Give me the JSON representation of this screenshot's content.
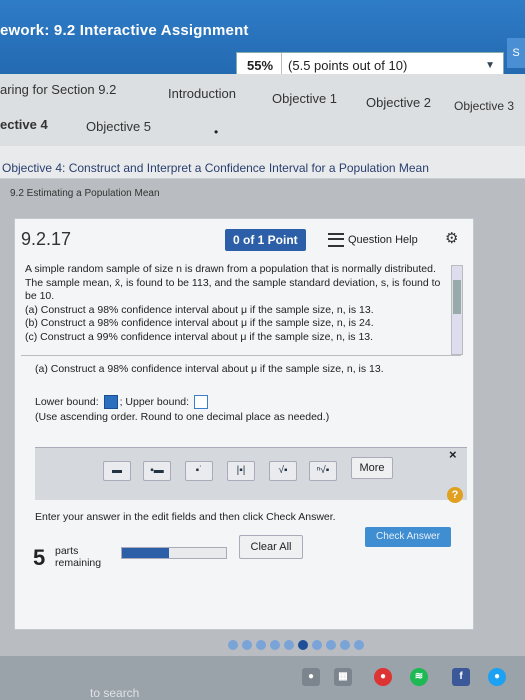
{
  "header": {
    "title": "ework: 9.2 Interactive Assignment",
    "score_pct": "55%",
    "score_points": "(5.5 points out of 10)",
    "corner_label": "S"
  },
  "nav": {
    "row1": [
      "aring for Section 9.2",
      "Introduction",
      "Objective 1",
      "Objective 2",
      "Objective 3"
    ],
    "row2_bold": "ective 4",
    "row2_item": "Objective 5",
    "objective_title": "Objective 4: Construct and Interpret a Confidence Interval for a Population Mean"
  },
  "section_label": "9.2 Estimating a Population Mean",
  "question": {
    "number": "9.2.17",
    "points": "0 of 1 Point",
    "help_label": "Question Help",
    "text": "A simple random sample of size n is drawn from a population that is normally distributed. The sample mean, x̄, is found to be 113, and the sample standard deviation, s, is found to be 10.",
    "part_a": "(a) Construct a 98% confidence interval about μ if the sample size, n, is 13.",
    "part_b": "(b) Construct a 98% confidence interval about μ if the sample size, n, is 24.",
    "part_c": "(c) Construct a 99% confidence interval about μ if the sample size, n, is 13.",
    "current_part": "(a) Construct a 98% confidence interval about μ if the sample size, n, is 13.",
    "lower_label": "Lower bound:",
    "upper_label": "Upper bound:",
    "hint": "(Use ascending order. Round to one decimal place as needed.)"
  },
  "toolbar": {
    "more_label": "More",
    "close_label": "×"
  },
  "footer": {
    "instructions": "Enter your answer in the edit fields and then click Check Answer.",
    "check_label": "Check Answer",
    "clear_label": "Clear All",
    "parts_count": "5",
    "parts_word1": "parts",
    "parts_word2": "remaining",
    "help_symbol": "?",
    "progress_fraction": 0.45
  },
  "taskbar": {
    "search_text": "to search"
  }
}
